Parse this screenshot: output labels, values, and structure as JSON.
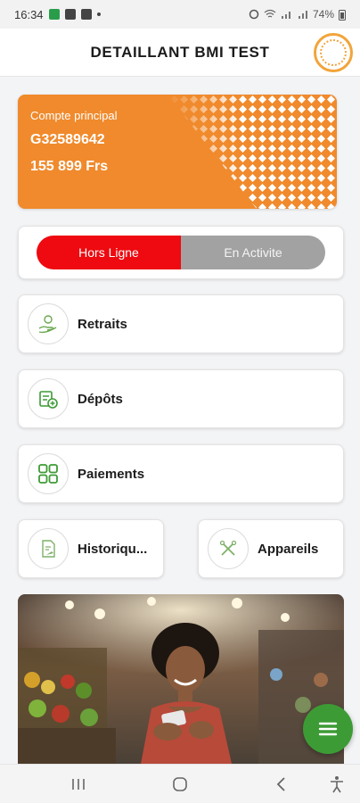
{
  "status_bar": {
    "time": "16:34",
    "battery": "74%"
  },
  "header": {
    "title": "DETAILLANT BMI TEST",
    "logo_icon": "bmi-logo"
  },
  "account": {
    "label": "Compte principal",
    "number": "G32589642",
    "balance": "155 899 Frs",
    "color": "#f08a2c"
  },
  "availability": {
    "offline_label": "Hors Ligne",
    "online_label": "En Activite",
    "selected": "Hors Ligne",
    "offline_color": "#ee0a10",
    "online_color": "#a2a2a2"
  },
  "menu": {
    "withdrawals": {
      "label": "Retraits",
      "icon": "hand-money-icon"
    },
    "deposits": {
      "label": "Dépôts",
      "icon": "deposit-icon"
    },
    "payments": {
      "label": "Paiements",
      "icon": "grid-icon"
    },
    "history": {
      "label": "Historiqu...",
      "icon": "history-icon"
    },
    "devices": {
      "label": "Appareils",
      "icon": "tools-icon"
    }
  },
  "accent_color": "#3d9b35",
  "fab": {
    "icon": "menu-icon"
  },
  "nav": {
    "recents_icon": "recents-icon",
    "home_icon": "home-icon",
    "back_icon": "back-icon",
    "accessibility_icon": "accessibility-icon"
  }
}
